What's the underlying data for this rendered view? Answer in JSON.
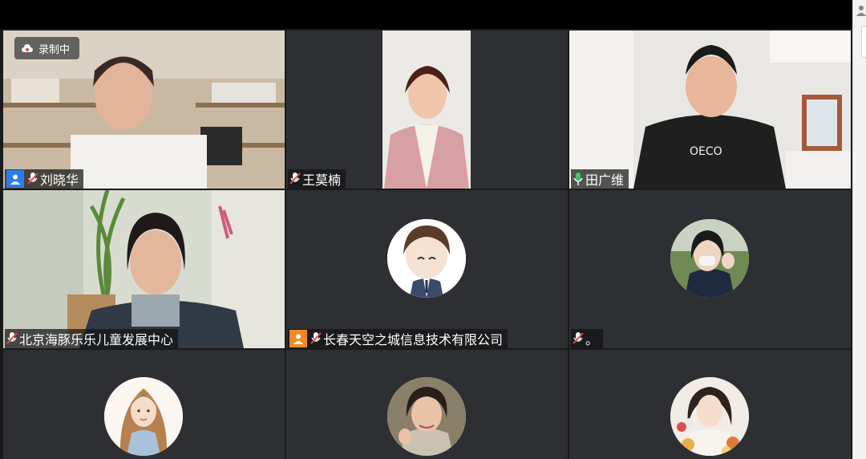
{
  "recording": {
    "label": "录制中"
  },
  "participants": [
    {
      "name": "刘晓华",
      "muted": true,
      "has_badge": true,
      "badge_color": "#2b7cf0"
    },
    {
      "name": "王莫楠",
      "muted": true,
      "has_badge": false
    },
    {
      "name": "田广维",
      "muted": false,
      "speaking": true,
      "has_badge": false
    },
    {
      "name": "北京海豚乐乐儿童发展中心",
      "muted": true,
      "has_badge": false
    },
    {
      "name": "长春天空之城信息技术有限公司",
      "muted": true,
      "has_badge": true,
      "badge_color": "#f08a24"
    },
    {
      "name": "。",
      "muted": true,
      "has_badge": false
    },
    {
      "name": "",
      "muted": true
    },
    {
      "name": "",
      "muted": true
    },
    {
      "name": "",
      "muted": true
    }
  ],
  "colors": {
    "active_speaker": "#3dc46a",
    "tile_bg": "#2d2f33",
    "muted_red": "#e5484d"
  }
}
